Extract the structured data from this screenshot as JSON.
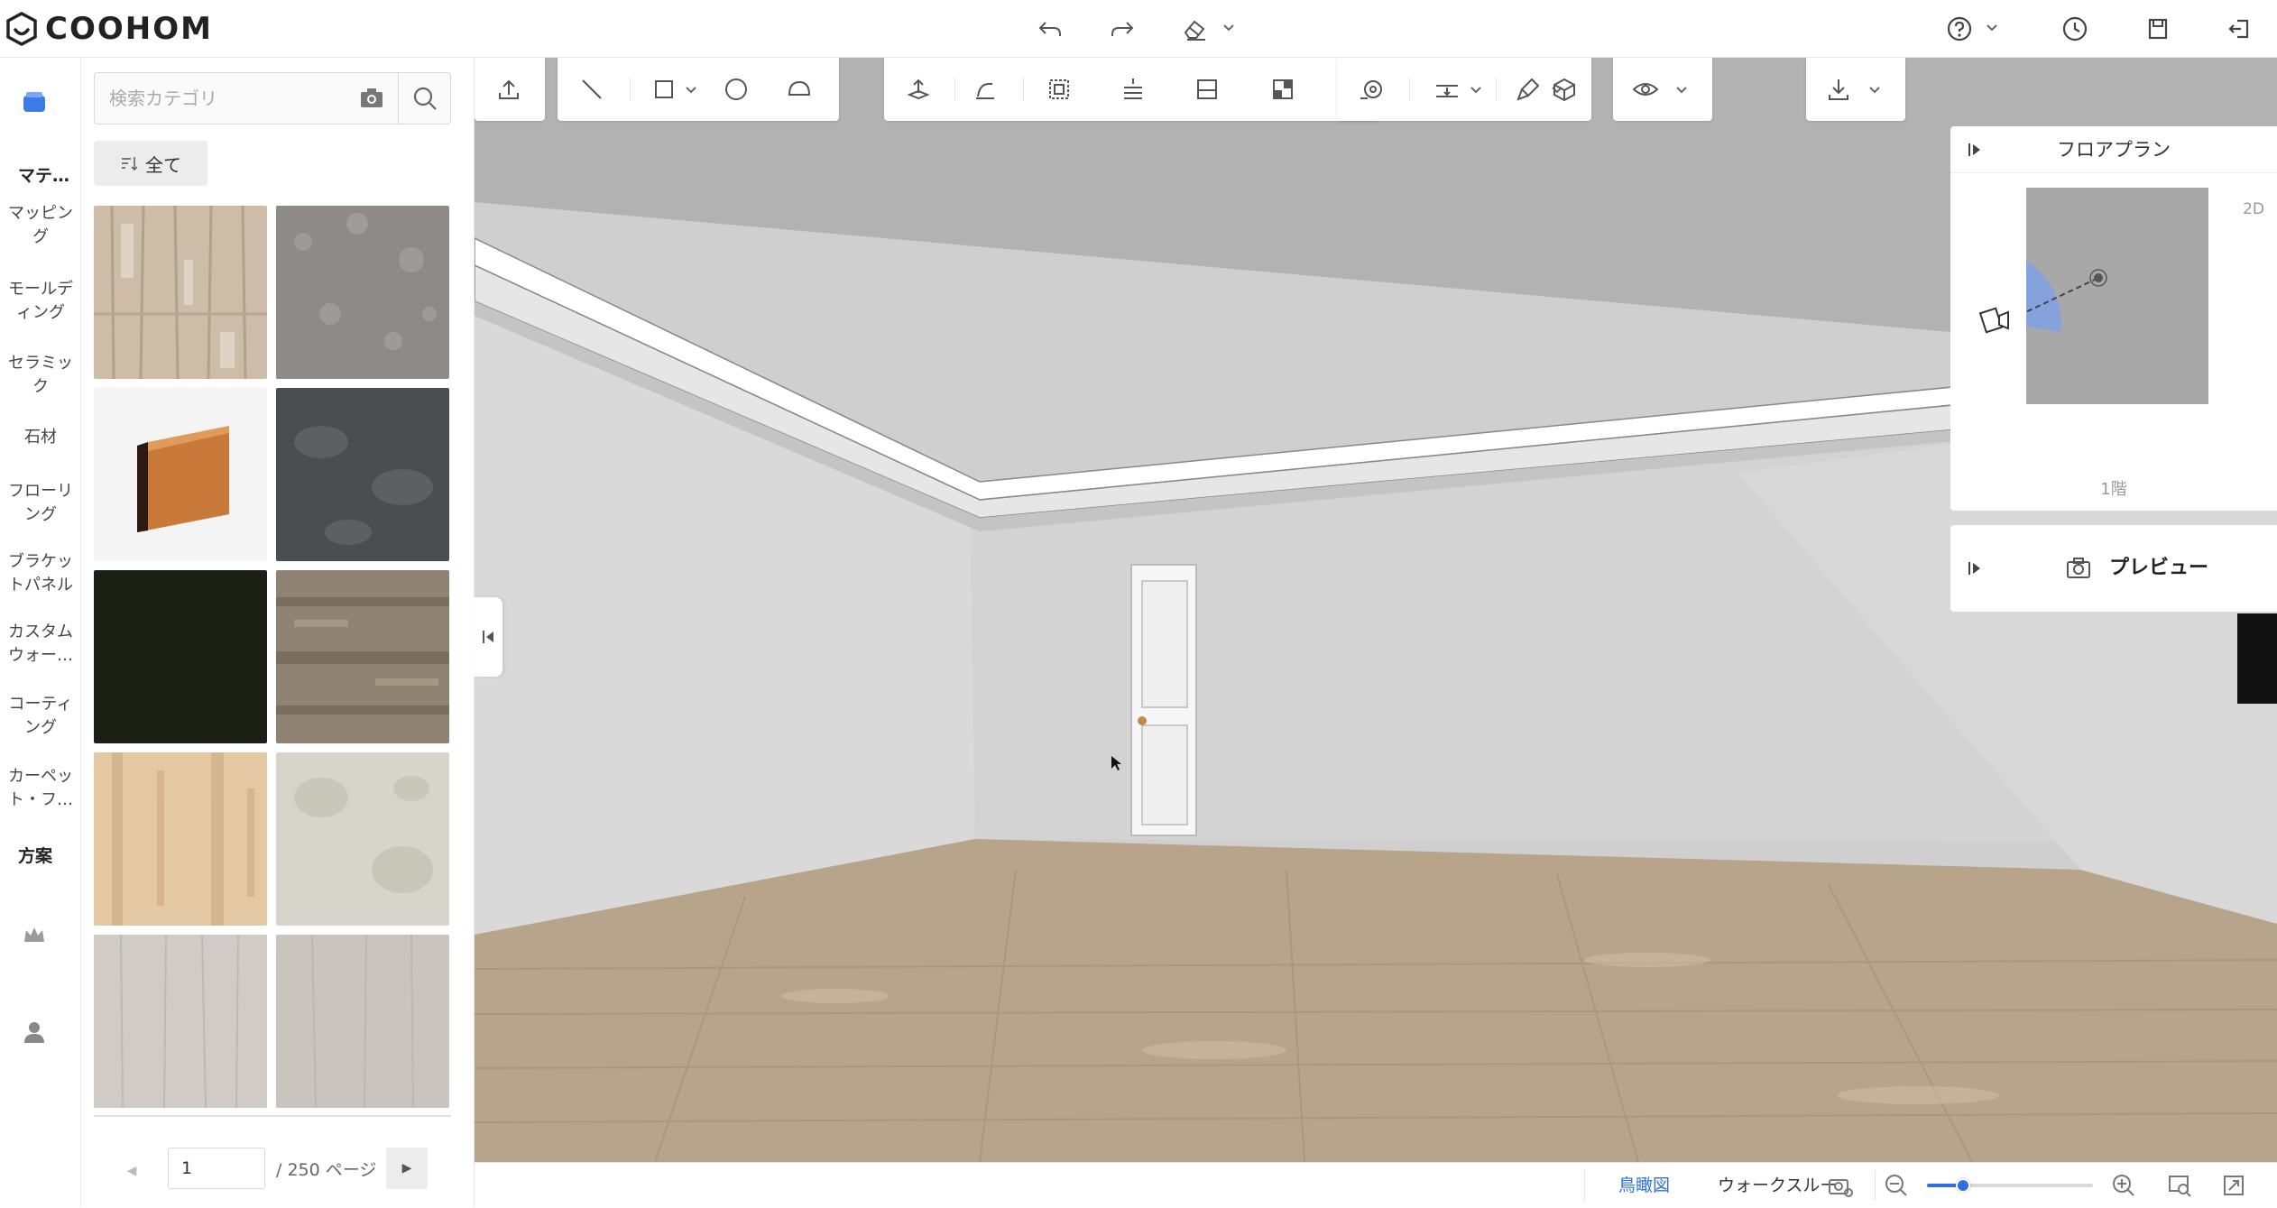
{
  "app": {
    "brand": "COOHOM"
  },
  "topbar": {
    "icons": [
      "undo-icon",
      "redo-icon",
      "eraser-icon",
      "help-icon",
      "history-icon",
      "save-icon",
      "exit-icon"
    ]
  },
  "leftnav": {
    "groups": [
      {
        "label": "マテ…"
      },
      {
        "label": "方案"
      }
    ],
    "items": [
      {
        "label": "マッピング"
      },
      {
        "label": "モールディング"
      },
      {
        "label": "セラミック"
      },
      {
        "label": "石材"
      },
      {
        "label": "フローリング"
      },
      {
        "label": "ブラケットパネル"
      },
      {
        "label": "カスタムウォー…"
      },
      {
        "label": "コーティング"
      },
      {
        "label": "カーペット・フ…"
      }
    ]
  },
  "panel": {
    "search_placeholder": "検索カテゴリ",
    "filter_label": "全て",
    "thumbnails": [
      {
        "name": "weathered-wood",
        "color": "#c9b8a3"
      },
      {
        "name": "gray-carpet",
        "color": "#8e8b88"
      },
      {
        "name": "wood-baseboard",
        "color": "#c97a3a"
      },
      {
        "name": "dark-stone",
        "color": "#4c4d51"
      },
      {
        "name": "black-green",
        "color": "#1b2015"
      },
      {
        "name": "brown-wood",
        "color": "#8f8272"
      },
      {
        "name": "light-oak",
        "color": "#e3c8a3"
      },
      {
        "name": "pale-marble",
        "color": "#d7d5cb"
      },
      {
        "name": "light-gray-wood",
        "color": "#d0ccc5"
      },
      {
        "name": "light-gray-texture",
        "color": "#c9c5be"
      }
    ],
    "page_value": "1",
    "page_total": "/ 250 ページ"
  },
  "floorplan": {
    "title": "フロアプラン",
    "mode": "2D",
    "floor": "1階"
  },
  "preview": {
    "label": "プレビュー"
  },
  "bottombar": {
    "view_bird": "鳥瞰図",
    "view_walk": "ウォークスルー",
    "zoom_fraction": 0.22
  },
  "colors": {
    "accent": "#2f6fe0",
    "nav_active": "#3a7be8"
  }
}
